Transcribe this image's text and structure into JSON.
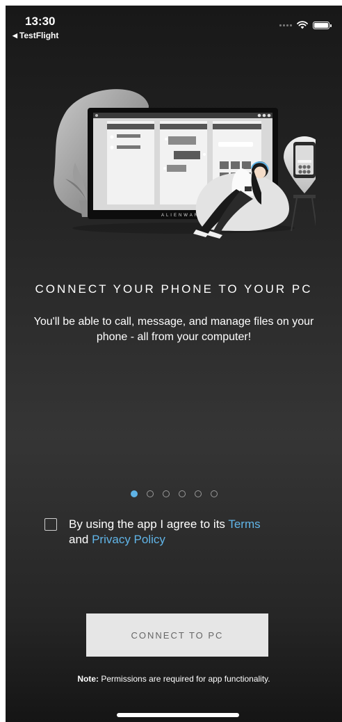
{
  "status_bar": {
    "time": "13:30",
    "back_label": "TestFlight"
  },
  "illustration": {
    "brand_text": "ALIENWARE"
  },
  "onboarding": {
    "headline": "CONNECT YOUR PHONE TO YOUR PC",
    "subtext": "You'll be able to call, message, and manage files on your phone - all from your computer!",
    "pages_total": 6,
    "active_page": 1
  },
  "consent": {
    "checked": false,
    "prefix": "By using the app I agree to its ",
    "terms_link": "Terms",
    "middle": "and ",
    "privacy_link": "Privacy Policy"
  },
  "connect_button": {
    "label": "CONNECT TO PC"
  },
  "note": {
    "bold": "Note:",
    "text": " Permissions are required for app functionality."
  },
  "colors": {
    "accent": "#5fb3e6",
    "button_bg": "#e6e6e6",
    "background_dark": "#262626"
  }
}
